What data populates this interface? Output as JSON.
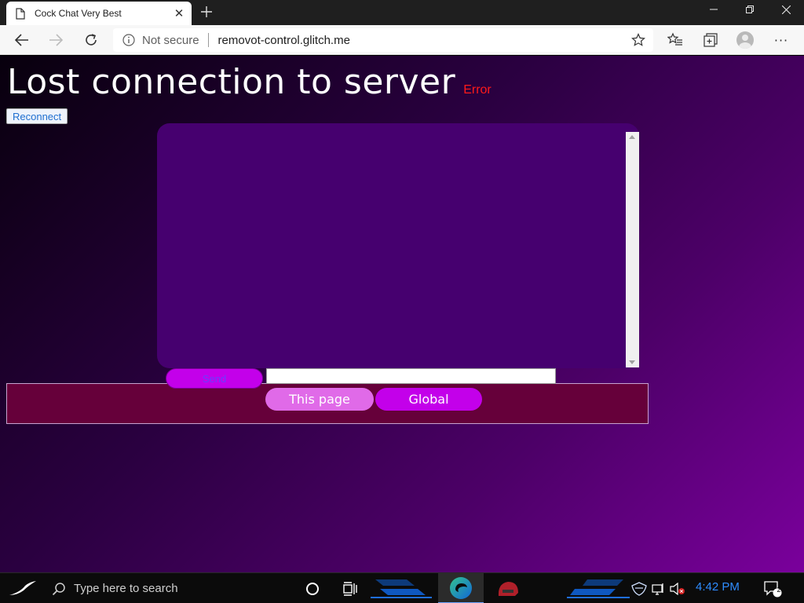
{
  "browser": {
    "tab_title": "Cock Chat Very Best",
    "security_label": "Not secure",
    "url": "removot-control.glitch.me"
  },
  "page": {
    "heading": "Lost connection to server",
    "error_label": "Error",
    "reconnect_label": "Reconnect",
    "send_label": "Send",
    "message_value": "",
    "tabs": [
      {
        "label": "This page"
      },
      {
        "label": "Global"
      }
    ]
  },
  "taskbar": {
    "search_placeholder": "Type here to search",
    "clock": "4:42 PM",
    "notification_count": "2"
  },
  "colors": {
    "chat_area": "#46006f",
    "tab_active": "#e06ae8",
    "tab_inactive": "#c300ea",
    "error": "#ff1a1a",
    "tabs_bar": "#66003a",
    "clock": "#2e8cff"
  }
}
